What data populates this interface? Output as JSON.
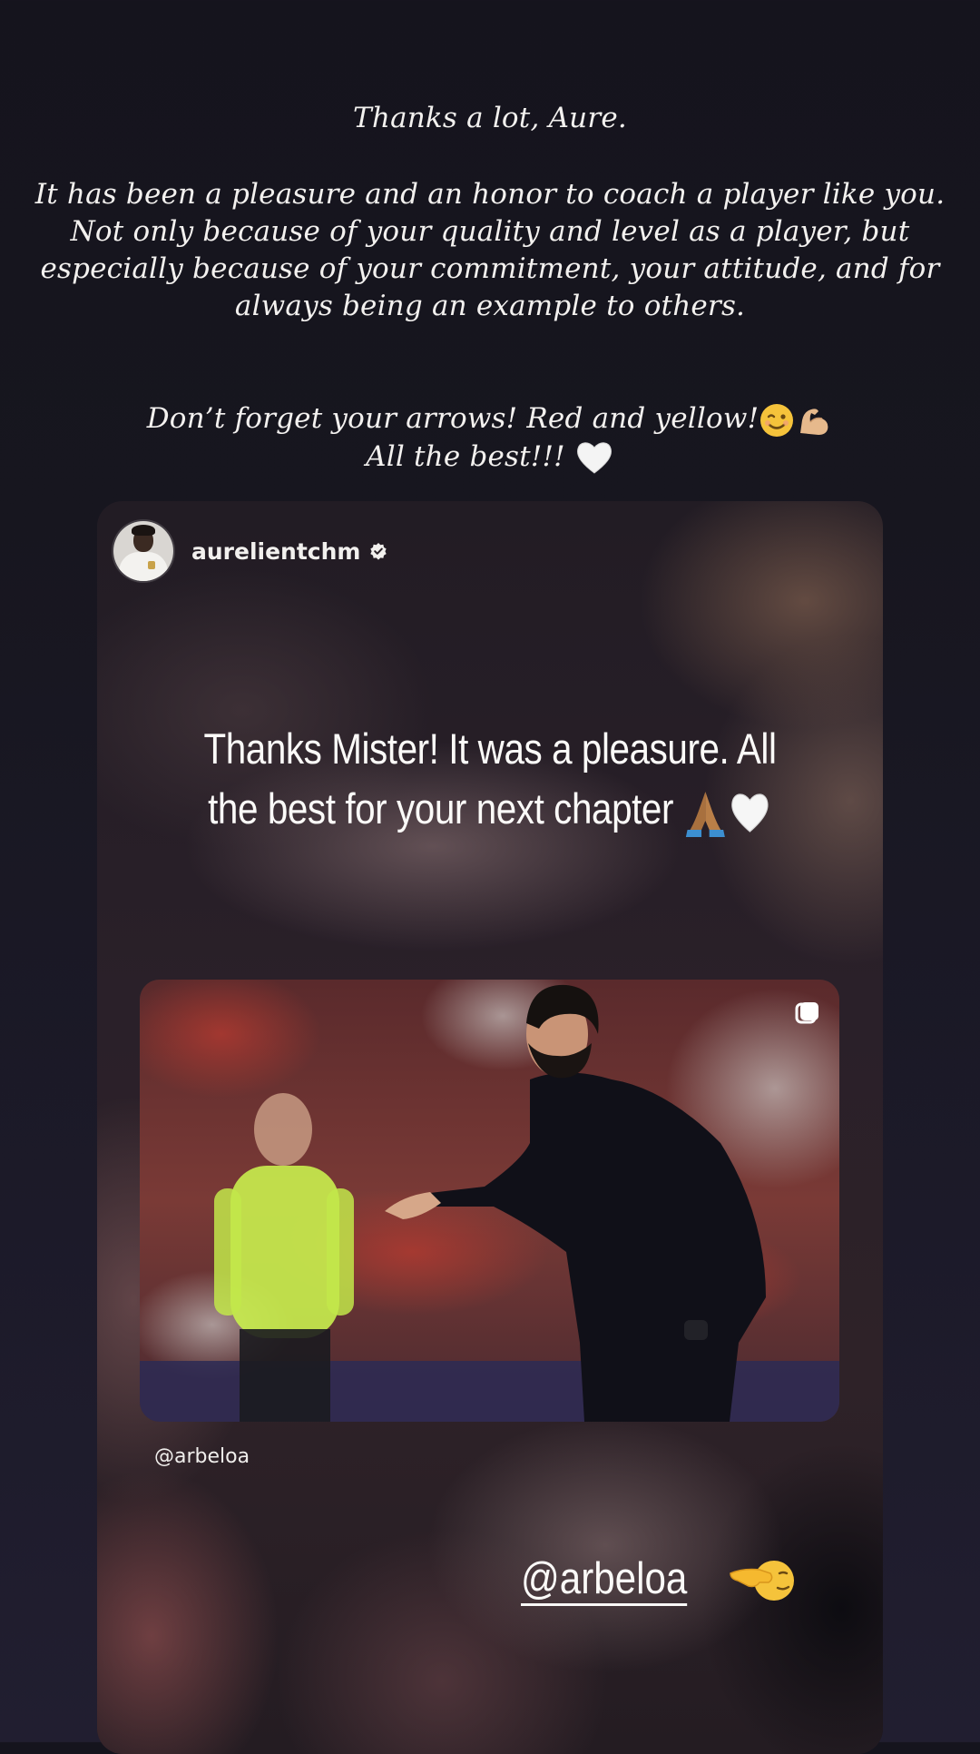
{
  "story_caption": {
    "greeting": "Thanks a lot, Aure.",
    "body": "It has been a pleasure and an honor to coach a player like you. Not only because of your quality and level as a player, but especially because of your commitment, your attitude, and for always being an example to others.",
    "arrows_line": "Don’t forget your arrows! Red and yellow!",
    "closing": "All the best!!!"
  },
  "shared_post": {
    "username": "aurelientchm",
    "verified": true,
    "reply_text": "Thanks Mister! It was a pleasure. All the best for your next chapter",
    "photo_handle": "@arbeloa",
    "mention_sticker": "@arbeloa"
  },
  "icons": {
    "verified": "verified-badge-icon",
    "multi_photo": "carousel-icon",
    "wink": "winking-face-emoji",
    "flexed": "flexed-biceps-emoji",
    "heart": "white-heart-emoji",
    "pray": "folded-hands-emoji",
    "point": "pointing-hand-emoji"
  },
  "colors": {
    "background": "#17161f",
    "text": "#f3f1ef",
    "emoji_yellow": "#f5c33b"
  }
}
